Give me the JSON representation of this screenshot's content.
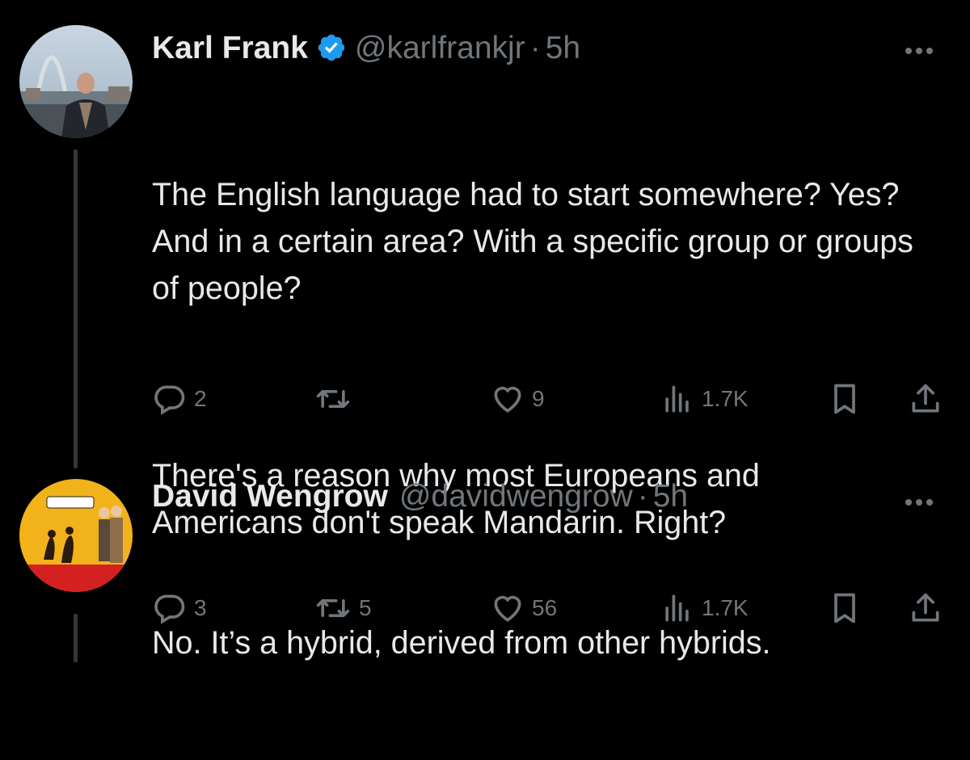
{
  "tweets": [
    {
      "author": {
        "name": "Karl Frank",
        "handle": "@karlfrankjr",
        "verified": true
      },
      "separator": "·",
      "time": "5h",
      "text_paragraphs": [
        "The English language had to start somewhere? Yes? And in a certain area? With a specific group or groups of people?",
        "There's a reason why most Europeans and Americans don't speak Mandarin. Right?"
      ],
      "stats": {
        "replies": "2",
        "reposts": "",
        "likes": "9",
        "views": "1.7K"
      }
    },
    {
      "author": {
        "name": "David Wengrow",
        "handle": "@davidwengrow",
        "verified": false
      },
      "separator": "·",
      "time": "5h",
      "text_paragraphs": [
        "No. It’s a hybrid, derived from other hybrids."
      ],
      "stats": {
        "replies": "3",
        "reposts": "5",
        "likes": "56",
        "views": "1.7K"
      }
    }
  ],
  "icons": {
    "verified": "verified-badge-icon",
    "more": "more-options-icon",
    "reply": "reply-icon",
    "repost": "repost-icon",
    "like": "like-icon",
    "views": "views-icon",
    "bookmark": "bookmark-icon",
    "share": "share-icon"
  },
  "colors": {
    "background": "#000000",
    "text": "#e7e9ea",
    "secondary": "#71767b",
    "verified": "#1d9bf0",
    "thread_line": "#333639"
  }
}
